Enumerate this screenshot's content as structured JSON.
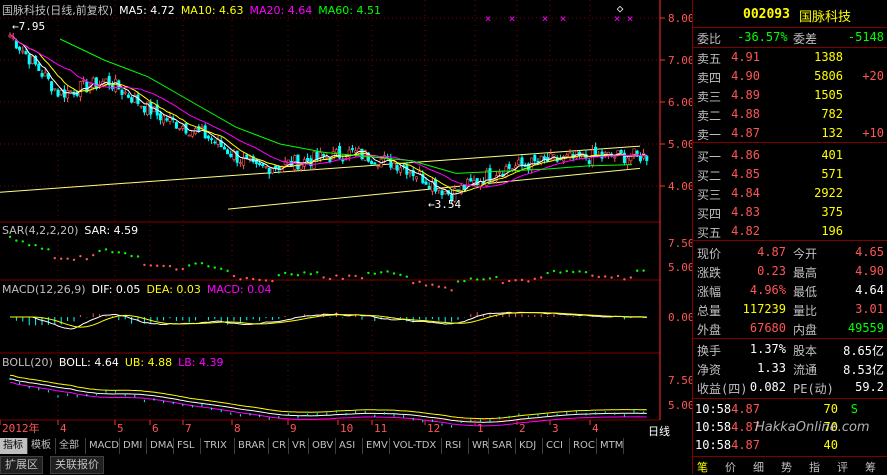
{
  "colors": {
    "red": "#ff5555",
    "green": "#00ff00",
    "yellow": "#ffff00",
    "white": "#ffffff",
    "magenta": "#ff00ff",
    "cyan": "#00ffff",
    "axis": "#ff3030",
    "grid": "#800000"
  },
  "main_legend": {
    "title": "国脉科技(日线,前复权)",
    "ma5": "MA5: 4.72",
    "ma10": "MA10: 4.63",
    "ma20": "MA20: 4.64",
    "ma60": "MA60: 4.51"
  },
  "price_axis": [
    "8.00",
    "7.00",
    "6.00",
    "5.00",
    "4.00"
  ],
  "high_label": "7.95",
  "low_label": "3.54",
  "sar_legend": {
    "title": "SAR(4,2,2,20)",
    "value": "SAR: 4.59"
  },
  "sar_axis": [
    "7.50",
    "5.00"
  ],
  "macd_legend": {
    "title": "MACD(12,26,9)",
    "dif": "DIF: 0.05",
    "dea": "DEA: 0.03",
    "macd": "MACD: 0.04"
  },
  "macd_axis": [
    "0.00"
  ],
  "boll_legend": {
    "title": "BOLL(20)",
    "boll": "BOLL: 4.64",
    "ub": "UB: 4.88",
    "lb": "LB: 4.39"
  },
  "boll_axis": [
    "7.50",
    "5.00"
  ],
  "date_axis": [
    "2012年",
    "4",
    "5",
    "6",
    "7",
    "8",
    "9",
    "10",
    "11",
    "12",
    "1",
    "2",
    "3",
    "4"
  ],
  "period_label": "日线",
  "chart_data": {
    "type": "line",
    "title": "国脉科技(日线,前复权)",
    "x": [
      "2012年",
      "4",
      "5",
      "6",
      "7",
      "8",
      "9",
      "10",
      "11",
      "12",
      "1",
      "2",
      "3",
      "4"
    ],
    "series": [
      {
        "name": "MA5",
        "values": [
          7.6,
          6.2,
          6.5,
          5.7,
          5.2,
          4.4,
          4.6,
          4.8,
          4.5,
          3.8,
          4.4,
          4.6,
          4.7,
          4.72
        ]
      },
      {
        "name": "MA60",
        "values": [
          7.5,
          7.0,
          6.6,
          6.0,
          5.4,
          5.0,
          4.8,
          4.7,
          4.6,
          4.3,
          4.35,
          4.4,
          4.48,
          4.51
        ]
      }
    ],
    "ylim": [
      3.5,
      8.0
    ],
    "annotations": [
      "7.95",
      "3.54"
    ]
  },
  "quote": {
    "code": "002093",
    "name": "国脉科技",
    "weibi_label": "委比",
    "weibi": "-36.57%",
    "weicha_label": "委差",
    "weicha": "-5148",
    "asks": [
      {
        "label": "卖五",
        "price": "4.91",
        "vol": "1388",
        "chg": ""
      },
      {
        "label": "卖四",
        "price": "4.90",
        "vol": "5806",
        "chg": "+20"
      },
      {
        "label": "卖三",
        "price": "4.89",
        "vol": "1505",
        "chg": ""
      },
      {
        "label": "卖二",
        "price": "4.88",
        "vol": "782",
        "chg": ""
      },
      {
        "label": "卖一",
        "price": "4.87",
        "vol": "132",
        "chg": "+10"
      }
    ],
    "bids": [
      {
        "label": "买一",
        "price": "4.86",
        "vol": "401"
      },
      {
        "label": "买二",
        "price": "4.85",
        "vol": "571"
      },
      {
        "label": "买三",
        "price": "4.84",
        "vol": "2922"
      },
      {
        "label": "买四",
        "price": "4.83",
        "vol": "375"
      },
      {
        "label": "买五",
        "price": "4.82",
        "vol": "196"
      }
    ],
    "stats": [
      {
        "l1": "现价",
        "v1": "4.87",
        "l2": "今开",
        "v2": "4.65"
      },
      {
        "l1": "涨跌",
        "v1": "0.23",
        "l2": "最高",
        "v2": "4.90"
      },
      {
        "l1": "涨幅",
        "v1": "4.96%",
        "l2": "最低",
        "v2": "4.64"
      },
      {
        "l1": "总量",
        "v1": "117239",
        "l2": "量比",
        "v2": "3.01"
      },
      {
        "l1": "外盘",
        "v1": "67680",
        "l2": "内盘",
        "v2": "49559"
      }
    ],
    "fin": [
      {
        "l1": "换手",
        "v1": "1.37%",
        "l2": "股本",
        "v2": "8.65亿"
      },
      {
        "l1": "净资",
        "v1": "1.33",
        "l2": "流通",
        "v2": "8.53亿"
      },
      {
        "l1": "收益(四)",
        "v1": "0.082",
        "l2": "PE(动)",
        "v2": "59.2"
      }
    ],
    "ticks": [
      {
        "time": "10:58",
        "price": "4.87",
        "vol": "70",
        "dir": "S"
      },
      {
        "time": "10:58",
        "price": "4.87",
        "vol": "70",
        "dir": ""
      },
      {
        "time": "10:58",
        "price": "4.87",
        "vol": "40",
        "dir": ""
      }
    ],
    "panel_tabs": [
      "笔",
      "价",
      "细",
      "势",
      "指",
      "评",
      "筹"
    ]
  },
  "bottom_tabs": [
    "指标",
    "模板",
    "全部",
    "MACD",
    "DMI",
    "DMA",
    "FSL",
    "TRIX",
    "BRAR",
    "CR",
    "VR",
    "OBV",
    "ASI",
    "EMV",
    "VOL-TDX",
    "RSI",
    "WR",
    "SAR",
    "KDJ",
    "CCI",
    "ROC",
    "MTM"
  ],
  "bottom_tabs2": [
    "扩展区",
    "关联报价"
  ],
  "watermark": "HakkaOnline.com"
}
